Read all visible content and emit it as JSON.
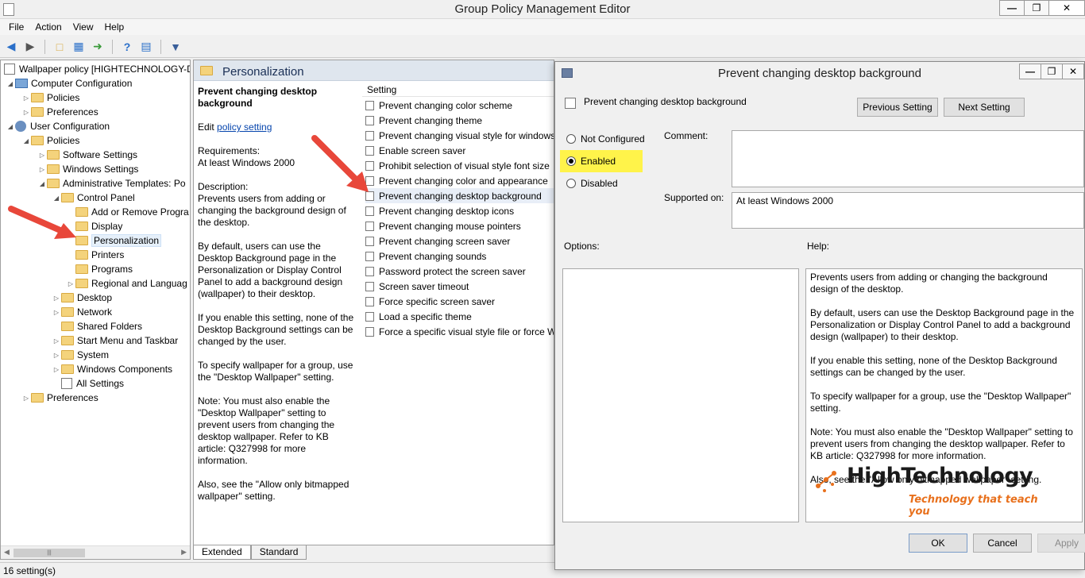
{
  "window": {
    "title": "Group Policy Management Editor",
    "minimize": "—",
    "restore": "❐",
    "close": "✕"
  },
  "menu": [
    "File",
    "Action",
    "View",
    "Help"
  ],
  "tree": {
    "root": "Wallpaper policy [HIGHTECHNOLOGY-D",
    "computer_configuration": "Computer Configuration",
    "cc_policies": "Policies",
    "cc_preferences": "Preferences",
    "user_configuration": "User Configuration",
    "uc_policies": "Policies",
    "software_settings": "Software Settings",
    "windows_settings": "Windows Settings",
    "admin_templates": "Administrative Templates: Po",
    "control_panel": "Control Panel",
    "add_remove": "Add or Remove Progra",
    "display": "Display",
    "personalization": "Personalization",
    "printers": "Printers",
    "programs": "Programs",
    "regional": "Regional and Languag",
    "desktop": "Desktop",
    "network": "Network",
    "shared_folders": "Shared Folders",
    "start_menu": "Start Menu and Taskbar",
    "system": "System",
    "windows_components": "Windows Components",
    "all_settings": "All Settings",
    "uc_preferences": "Preferences"
  },
  "middle": {
    "header": "Personalization",
    "desc_title": "Prevent changing desktop background",
    "edit_prefix": "Edit",
    "edit_link": "policy setting",
    "requirements_label": "Requirements:",
    "requirements_value": "At least Windows 2000",
    "description_label": "Description:",
    "description_p1": "Prevents users from adding or changing the background design of the desktop.",
    "description_p2": "By default, users can use the Desktop Background page in the Personalization or Display Control Panel to add a background design (wallpaper) to their desktop.",
    "description_p3": "If you enable this setting, none of the Desktop Background settings can be changed by the user.",
    "description_p4": "To specify wallpaper for a group, use the \"Desktop Wallpaper\" setting.",
    "description_p5": "Note: You must also enable the \"Desktop Wallpaper\" setting to prevent users from changing the desktop wallpaper. Refer to KB article: Q327998 for more information.",
    "description_p6": "Also, see the \"Allow only bitmapped wallpaper\" setting.",
    "setting_column": "Setting",
    "settings": [
      "Prevent changing color scheme",
      "Prevent changing theme",
      "Prevent changing visual style for windows",
      "Enable screen saver",
      "Prohibit selection of visual style font size",
      "Prevent changing color and appearance",
      "Prevent changing desktop background",
      "Prevent changing desktop icons",
      "Prevent changing mouse pointers",
      "Prevent changing screen saver",
      "Prevent changing sounds",
      "Password protect the screen saver",
      "Screen saver timeout",
      "Force specific screen saver",
      "Load a specific theme",
      "Force a specific visual style file or force W"
    ],
    "selected_index": 6,
    "tab_extended": "Extended",
    "tab_standard": "Standard"
  },
  "status": "16 setting(s)",
  "dialog": {
    "title": "Prevent changing desktop background",
    "heading": "Prevent changing desktop background",
    "previous_setting": "Previous Setting",
    "next_setting": "Next Setting",
    "not_configured": "Not Configured",
    "enabled": "Enabled",
    "disabled": "Disabled",
    "selected_option": "enabled",
    "comment_label": "Comment:",
    "comment_value": "",
    "supported_label": "Supported on:",
    "supported_value": "At least Windows 2000",
    "options_label": "Options:",
    "help_label": "Help:",
    "help_p1": "Prevents users from adding or changing the background design of the desktop.",
    "help_p2": "By default, users can use the Desktop Background page in the Personalization or Display Control Panel to add a background design (wallpaper) to their desktop.",
    "help_p3": "If you enable this setting, none of the Desktop Background settings can be changed by the user.",
    "help_p4": "To specify wallpaper for a group, use the \"Desktop Wallpaper\" setting.",
    "help_p5": "Note: You must also enable the \"Desktop Wallpaper\" setting to prevent users from changing the desktop wallpaper. Refer to KB article: Q327998 for more information.",
    "help_p6": "Also, see the \"Allow only bitmapped wallpaper\" setting.",
    "ok": "OK",
    "cancel": "Cancel",
    "apply": "Apply"
  },
  "watermark": {
    "brand": "HighTechnology",
    "tagline": "Technology that teach you"
  },
  "colors": {
    "highlight_yellow": "#fff34a",
    "arrow_red": "#e8473a",
    "brand_orange": "#e8701c"
  }
}
